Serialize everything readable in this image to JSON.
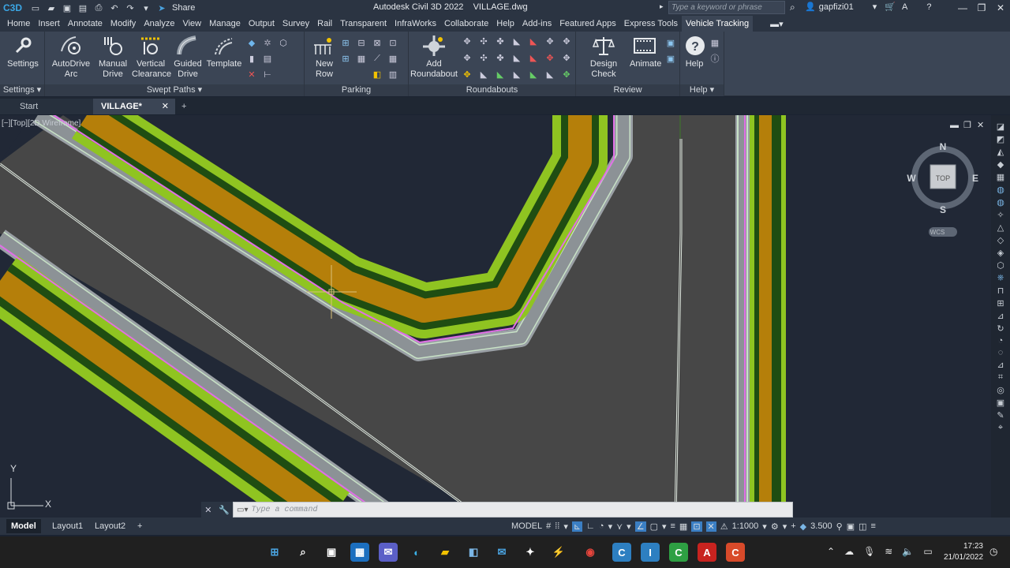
{
  "window": {
    "title": "Autodesk Civil 3D 2022",
    "file": "VILLAGE.dwg",
    "app_logo": "C3D",
    "share_label": "Share",
    "search_placeholder": "Type a keyword or phrase",
    "user": "gapfizi01"
  },
  "ribbon_tabs": [
    {
      "label": "Home"
    },
    {
      "label": "Insert"
    },
    {
      "label": "Annotate"
    },
    {
      "label": "Modify"
    },
    {
      "label": "Analyze"
    },
    {
      "label": "View"
    },
    {
      "label": "Manage"
    },
    {
      "label": "Output"
    },
    {
      "label": "Survey"
    },
    {
      "label": "Rail"
    },
    {
      "label": "Transparent"
    },
    {
      "label": "InfraWorks"
    },
    {
      "label": "Collaborate"
    },
    {
      "label": "Help"
    },
    {
      "label": "Add-ins"
    },
    {
      "label": "Featured Apps"
    },
    {
      "label": "Express Tools"
    },
    {
      "label": "Vehicle Tracking"
    }
  ],
  "ribbon": {
    "settings": {
      "button": "Settings",
      "panel": "Settings"
    },
    "swept": {
      "autodrive": "AutoDrive",
      "autodrive_sub": "Arc",
      "manual": "Manual",
      "manual_sub": "Drive",
      "vertical": "Vertical",
      "vertical_sub": "Clearance",
      "guided": "Guided",
      "guided_sub": "Drive",
      "template": "Template",
      "panel": "Swept Paths"
    },
    "parking": {
      "new": "New",
      "new_sub": "Row",
      "panel": "Parking"
    },
    "roundabouts": {
      "add": "Add",
      "add_sub": "Roundabout",
      "panel": "Roundabouts"
    },
    "review": {
      "design_check": "Design Check",
      "animate": "Animate",
      "panel": "Review"
    },
    "help": {
      "button": "Help",
      "panel": "Help"
    }
  },
  "file_tabs": {
    "start": "Start",
    "active": "VILLAGE*"
  },
  "viewport": {
    "label": "[−][Top][2D Wireframe]",
    "compass": {
      "n": "N",
      "s": "S",
      "e": "E",
      "w": "W",
      "cube": "TOP",
      "ucs": "WCS"
    },
    "ucs_x": "X",
    "ucs_y": "Y"
  },
  "command": {
    "placeholder": "Type a command"
  },
  "layouts": [
    {
      "label": "Model"
    },
    {
      "label": "Layout1"
    },
    {
      "label": "Layout2"
    }
  ],
  "status": {
    "model": "MODEL",
    "scale": "1:1000",
    "lineweight": "3.500"
  },
  "taskbar": {
    "time": "17:23",
    "date": "21/01/2022"
  },
  "colors": {
    "road_light_green": "#8fc421",
    "road_dark_green": "#1f4d12",
    "road_orange": "#b57f0a",
    "kerb_grey": "#9aa0a5",
    "pink_line": "#e06ee6",
    "pavement": "#474747",
    "background": "#212836"
  }
}
